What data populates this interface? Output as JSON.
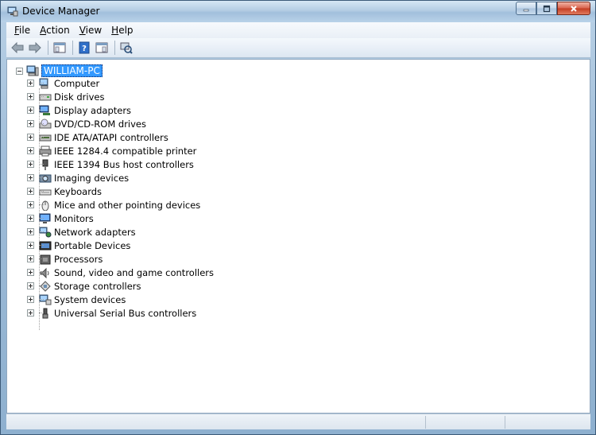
{
  "window": {
    "title": "Device Manager"
  },
  "menubar": {
    "items": [
      {
        "label": "File",
        "accel": "F",
        "rest": "ile"
      },
      {
        "label": "Action",
        "accel": "A",
        "rest": "ction"
      },
      {
        "label": "View",
        "accel": "V",
        "rest": "iew"
      },
      {
        "label": "Help",
        "accel": "H",
        "rest": "elp"
      }
    ]
  },
  "toolbar": {
    "buttons": [
      "back-arrow-icon",
      "forward-arrow-icon",
      "console-tree-icon",
      "help-icon",
      "properties-icon",
      "scan-hardware-icon"
    ]
  },
  "tree": {
    "root": "WILLIAM-PC",
    "items": [
      {
        "label": "Computer",
        "icon": "computer-icon"
      },
      {
        "label": "Disk drives",
        "icon": "disk-drive-icon"
      },
      {
        "label": "Display adapters",
        "icon": "display-adapter-icon"
      },
      {
        "label": "DVD/CD-ROM drives",
        "icon": "dvd-drive-icon"
      },
      {
        "label": "IDE ATA/ATAPI controllers",
        "icon": "ide-controller-icon"
      },
      {
        "label": "IEEE 1284.4 compatible printer",
        "icon": "printer-icon"
      },
      {
        "label": "IEEE 1394 Bus host controllers",
        "icon": "firewire-icon"
      },
      {
        "label": "Imaging devices",
        "icon": "imaging-device-icon"
      },
      {
        "label": "Keyboards",
        "icon": "keyboard-icon"
      },
      {
        "label": "Mice and other pointing devices",
        "icon": "mouse-icon"
      },
      {
        "label": "Monitors",
        "icon": "monitor-icon"
      },
      {
        "label": "Network adapters",
        "icon": "network-adapter-icon"
      },
      {
        "label": "Portable Devices",
        "icon": "portable-device-icon"
      },
      {
        "label": "Processors",
        "icon": "processor-icon"
      },
      {
        "label": "Sound, video and game controllers",
        "icon": "sound-icon"
      },
      {
        "label": "Storage controllers",
        "icon": "storage-controller-icon"
      },
      {
        "label": "System devices",
        "icon": "system-device-icon"
      },
      {
        "label": "Universal Serial Bus controllers",
        "icon": "usb-icon"
      }
    ]
  },
  "colors": {
    "selection": "#3399ff",
    "title_bar": "#b4cde3",
    "close_button": "#c23c22"
  }
}
